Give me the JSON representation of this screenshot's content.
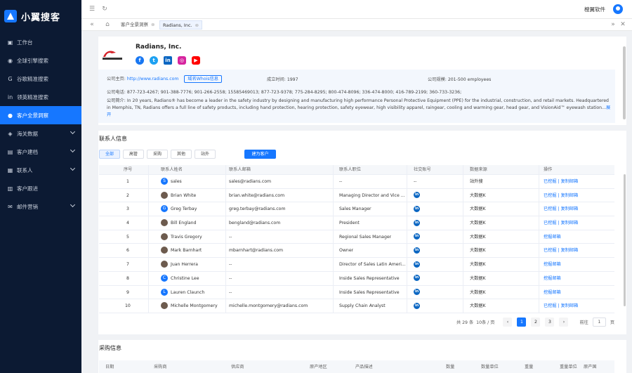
{
  "app": {
    "name": "小翼搜客"
  },
  "sidebar": {
    "items": [
      {
        "label": "工作台",
        "icon": "dashboard-icon"
      },
      {
        "label": "全球引擎搜索",
        "icon": "globe-search-icon"
      },
      {
        "label": "谷歌精准搜索",
        "icon": "google-icon"
      },
      {
        "label": "领英精准搜索",
        "icon": "linkedin-icon"
      },
      {
        "label": "客户全景洞察",
        "icon": "user-icon",
        "active": true
      },
      {
        "label": "海关数据",
        "icon": "customs-icon",
        "expandable": true
      },
      {
        "label": "客户建档",
        "icon": "archive-icon",
        "expandable": true
      },
      {
        "label": "联系人",
        "icon": "contacts-icon",
        "expandable": true
      },
      {
        "label": "客户跟进",
        "icon": "follow-up-icon"
      },
      {
        "label": "邮件营销",
        "icon": "mail-icon",
        "expandable": true
      }
    ]
  },
  "header": {
    "company": "橙翼软件"
  },
  "tabs": [
    {
      "label": "客户全景洞察"
    },
    {
      "label": "Radians, Inc.",
      "active": true
    }
  ],
  "profile": {
    "name": "Radians, Inc.",
    "logo_text": "RADIANS",
    "social": [
      "facebook-icon",
      "twitter-icon",
      "linkedin-icon",
      "instagram-icon",
      "youtube-icon"
    ],
    "website_label": "公司主页:",
    "website": "http://www.radians.com",
    "whois_button": "域名Whois信息",
    "founded_label": "成立时间:",
    "founded": "1997",
    "size_label": "公司规模:",
    "size": "201-500 employees",
    "phone_label": "公司电话:",
    "phones": "877-723-4267; 901-388-7776; 901-266-2558; 15585469013; 877-723-9378; 775-284-8295; 800-474-8096; 336-474-8000; 416-789-2199; 360-733-3236;",
    "intro_label": "公司简介:",
    "intro": "In 20 years, Radians® has become a leader in the safety industry by designing and manufacturing high performance Personal Protective Equipment (PPE) for the industrial, construction, and retail markets. Headquartered in Memphis, TN, Radians offers a full line of safety products, including hand protection, hearing protection, safety eyewear, high visibility apparel, raingear, cooling and warming gear, head gear, and VisionAid™ eyewash station...",
    "expand": "展开"
  },
  "contacts": {
    "title": "联系人信息",
    "filters": [
      "全部",
      "高管",
      "采购",
      "其他",
      "站外"
    ],
    "add_button": "建为客户",
    "columns": [
      "序号",
      "联系人姓名",
      "联系人邮箱",
      "联系人职位",
      "社交账号",
      "数据来源",
      "操作"
    ],
    "rows": [
      {
        "no": "1",
        "avatar": "S",
        "name": "sales",
        "email": "sales@radians.com",
        "title": "--",
        "social": "--",
        "source": "站外搜",
        "ops": "已挖掘 | 复制邮箱"
      },
      {
        "no": "2",
        "avatar": "photo",
        "name": "Brian White",
        "email": "brian.white@radians.com",
        "title": "Managing Director and Vice ...",
        "social": "in",
        "source": "大数据K",
        "ops": "已挖掘 | 复制邮箱"
      },
      {
        "no": "3",
        "avatar": "G",
        "name": "Greg Terbay",
        "email": "greg.terbay@radians.com",
        "title": "Sales Manager",
        "social": "in",
        "source": "大数据K",
        "ops": "已挖掘 | 复制邮箱"
      },
      {
        "no": "4",
        "avatar": "photo",
        "name": "Bill England",
        "email": "bengland@radians.com",
        "title": "President",
        "social": "in",
        "source": "大数据K",
        "ops": "已挖掘 | 复制邮箱"
      },
      {
        "no": "5",
        "avatar": "photo",
        "name": "Travis Gregory",
        "email": "--",
        "title": "Regional Sales Manager",
        "social": "in",
        "source": "大数据K",
        "ops": "挖掘邮箱"
      },
      {
        "no": "6",
        "avatar": "photo",
        "name": "Mark Barnhart",
        "email": "mbarnhart@radians.com",
        "title": "Owner",
        "social": "in",
        "source": "大数据K",
        "ops": "已挖掘 | 复制邮箱"
      },
      {
        "no": "7",
        "avatar": "photo",
        "name": "Juan Herrera",
        "email": "--",
        "title": "Director of Sales Latin Ameri...",
        "social": "in",
        "source": "大数据K",
        "ops": "挖掘邮箱"
      },
      {
        "no": "8",
        "avatar": "C",
        "name": "Christine Lee",
        "email": "--",
        "title": "Inside Sales Representative",
        "social": "in",
        "source": "大数据K",
        "ops": "挖掘邮箱"
      },
      {
        "no": "9",
        "avatar": "L",
        "name": "Lauren Claunch",
        "email": "--",
        "title": "Inside Sales Representative",
        "social": "in",
        "source": "大数据K",
        "ops": "挖掘邮箱"
      },
      {
        "no": "10",
        "avatar": "photo",
        "name": "Michelle Montgomery",
        "email": "michelle.montgomery@radians.com",
        "title": "Supply Chain Analyst",
        "social": "in",
        "source": "大数据K",
        "ops": "已挖掘 | 复制邮箱"
      }
    ],
    "pagination": {
      "summary": "共 29 条",
      "page_size": "10条 / 页",
      "pages": [
        "1",
        "2",
        "3"
      ],
      "current": "1",
      "goto_label": "前往",
      "goto_value": "1",
      "goto_suffix": "页"
    }
  },
  "purchase": {
    "title": "采购信息",
    "columns": [
      "日期",
      "采购商",
      "供应商",
      "原产地区",
      "产品描述",
      "数量",
      "数量单位",
      "重量",
      "重量单位",
      "原产国"
    ]
  }
}
